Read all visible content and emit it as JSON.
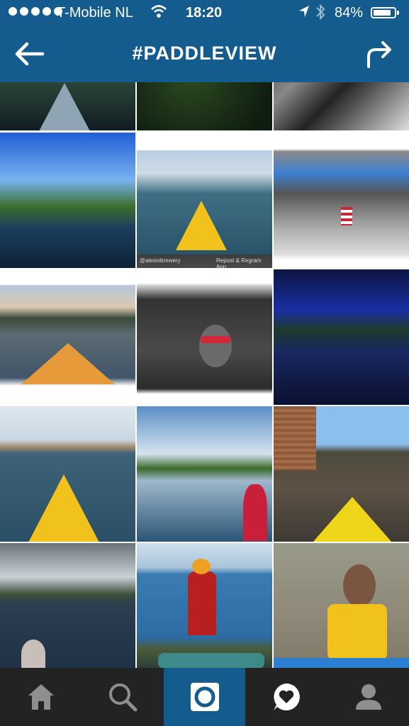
{
  "status_bar": {
    "carrier": "T-Mobile NL",
    "time": "18:20",
    "battery_percent": "84%",
    "battery_level": 0.84,
    "icons": [
      "signal-dots-icon",
      "wifi-icon",
      "location-arrow-icon",
      "bluetooth-icon",
      "battery-icon"
    ]
  },
  "nav": {
    "title": "#PADDLEVIEW",
    "back_icon": "back-arrow-icon",
    "share_icon": "share-arrow-icon"
  },
  "grid": {
    "photos": [
      {
        "subject": "kayak bow on dark lake"
      },
      {
        "subject": "green algae underwater"
      },
      {
        "subject": "black and white kayak"
      },
      {
        "subject": "paddle and forest lake"
      },
      {
        "subject": "yellow kayak bow on bay"
      },
      {
        "subject": "kayak with american flag"
      },
      {
        "subject": "kayak on mountain lake"
      },
      {
        "subject": "selfie with red sunglasses"
      },
      {
        "subject": "blue night lake"
      },
      {
        "subject": "yellow kayak on bay"
      },
      {
        "subject": "red kayak on marsh"
      },
      {
        "subject": "yellow kayak under bridge"
      },
      {
        "subject": "canoe on stormy lake"
      },
      {
        "subject": "person in orange hat fishing"
      },
      {
        "subject": "kayaker in life vest"
      }
    ],
    "watermark": {
      "handle": "@alexiobrewery",
      "repost": "Repost & Regram App"
    }
  },
  "tabbar": {
    "tabs": [
      {
        "icon": "home-icon",
        "active": false
      },
      {
        "icon": "search-icon",
        "active": false
      },
      {
        "icon": "camera-icon",
        "active": true
      },
      {
        "icon": "activity-heart-icon",
        "active": false
      },
      {
        "icon": "profile-icon",
        "active": false
      }
    ]
  },
  "colors": {
    "header": "#135c8d",
    "tabbar": "#232323",
    "active_tab": "#135c8d"
  }
}
